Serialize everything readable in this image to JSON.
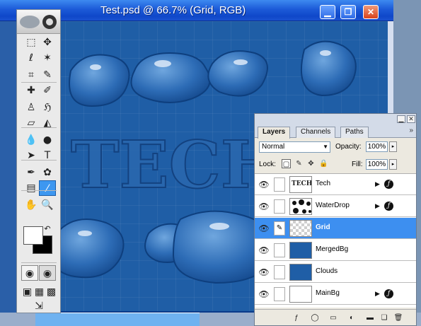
{
  "window": {
    "title": "Test.psd @ 66.7% (Grid, RGB)",
    "minimize_glyph": "▁",
    "maximize_glyph": "❐",
    "close_glyph": "✕"
  },
  "canvas": {
    "background_color": "#1f5ea6",
    "watermark_letters": "TECH"
  },
  "tools": {
    "items": [
      {
        "name": "marquee-tool-icon",
        "glyph": "⬚"
      },
      {
        "name": "move-tool-icon",
        "glyph": "✥"
      },
      {
        "name": "lasso-tool-icon",
        "glyph": "ℓ"
      },
      {
        "name": "magic-wand-tool-icon",
        "glyph": "✶"
      },
      {
        "name": "crop-tool-icon",
        "glyph": "⌗"
      },
      {
        "name": "slice-tool-icon",
        "glyph": "✎"
      },
      {
        "name": "healing-brush-tool-icon",
        "glyph": "✚"
      },
      {
        "name": "brush-tool-icon",
        "glyph": "✐"
      },
      {
        "name": "clone-stamp-tool-icon",
        "glyph": "♙"
      },
      {
        "name": "history-brush-tool-icon",
        "glyph": "ℌ"
      },
      {
        "name": "eraser-tool-icon",
        "glyph": "▱"
      },
      {
        "name": "paint-bucket-tool-icon",
        "glyph": "◭"
      },
      {
        "name": "blur-tool-icon",
        "glyph": "💧"
      },
      {
        "name": "dodge-tool-icon",
        "glyph": "●"
      },
      {
        "name": "path-selection-tool-icon",
        "glyph": "➤"
      },
      {
        "name": "type-tool-icon",
        "glyph": "T"
      },
      {
        "name": "pen-tool-icon",
        "glyph": "✒"
      },
      {
        "name": "custom-shape-tool-icon",
        "glyph": "✿"
      },
      {
        "name": "notes-tool-icon",
        "glyph": "▤"
      },
      {
        "name": "eyedropper-tool-icon",
        "glyph": "⁄"
      },
      {
        "name": "hand-tool-icon",
        "glyph": "✋"
      },
      {
        "name": "zoom-tool-icon",
        "glyph": "🔍"
      }
    ],
    "foreground_color": "#ffffff",
    "background_color": "#000000",
    "swap_glyph": "↶",
    "standard_mode_glyph": "◉",
    "quickmask_mode_glyph": "◉",
    "screen_modes": [
      "▣",
      "▦",
      "▩"
    ],
    "jump_to_glyph": "⇲"
  },
  "layers_panel": {
    "tabs": [
      "Layers",
      "Channels",
      "Paths"
    ],
    "menu_glyph": "»",
    "minimize_glyph": "▁",
    "close_glyph": "✕",
    "blend_mode": "Normal",
    "opacity_label": "Opacity:",
    "opacity_value": "100%",
    "lock_label": "Lock:",
    "fill_label": "Fill:",
    "fill_value": "100%",
    "stepper_glyph": "▸",
    "lock_icons": [
      "▢",
      "✎",
      "✥",
      "🔒"
    ],
    "layers": [
      {
        "name": "Tech",
        "visible": true,
        "selected": false,
        "has_effects": true,
        "thumb": "tech"
      },
      {
        "name": "WaterDrop",
        "visible": true,
        "selected": false,
        "has_effects": true,
        "thumb": "drops"
      },
      {
        "name": "Grid",
        "visible": true,
        "selected": true,
        "has_effects": false,
        "thumb": "checker"
      },
      {
        "name": "MergedBg",
        "visible": true,
        "selected": false,
        "has_effects": false,
        "thumb": "blue"
      },
      {
        "name": "Clouds",
        "visible": true,
        "selected": false,
        "has_effects": false,
        "thumb": "blue"
      },
      {
        "name": "MainBg",
        "visible": true,
        "selected": false,
        "has_effects": true,
        "thumb": "white"
      }
    ],
    "thumb_tech_text": "TECH",
    "eye_glyph": "👁",
    "brush_glyph": "✎",
    "fx_glyph": "ƒ",
    "expand_glyph": "▶",
    "bottom_icons": [
      "ƒ",
      "◯",
      "▭",
      "◐",
      "▬",
      "❏",
      "🗑"
    ],
    "selection_color": "#3d8ff0"
  }
}
